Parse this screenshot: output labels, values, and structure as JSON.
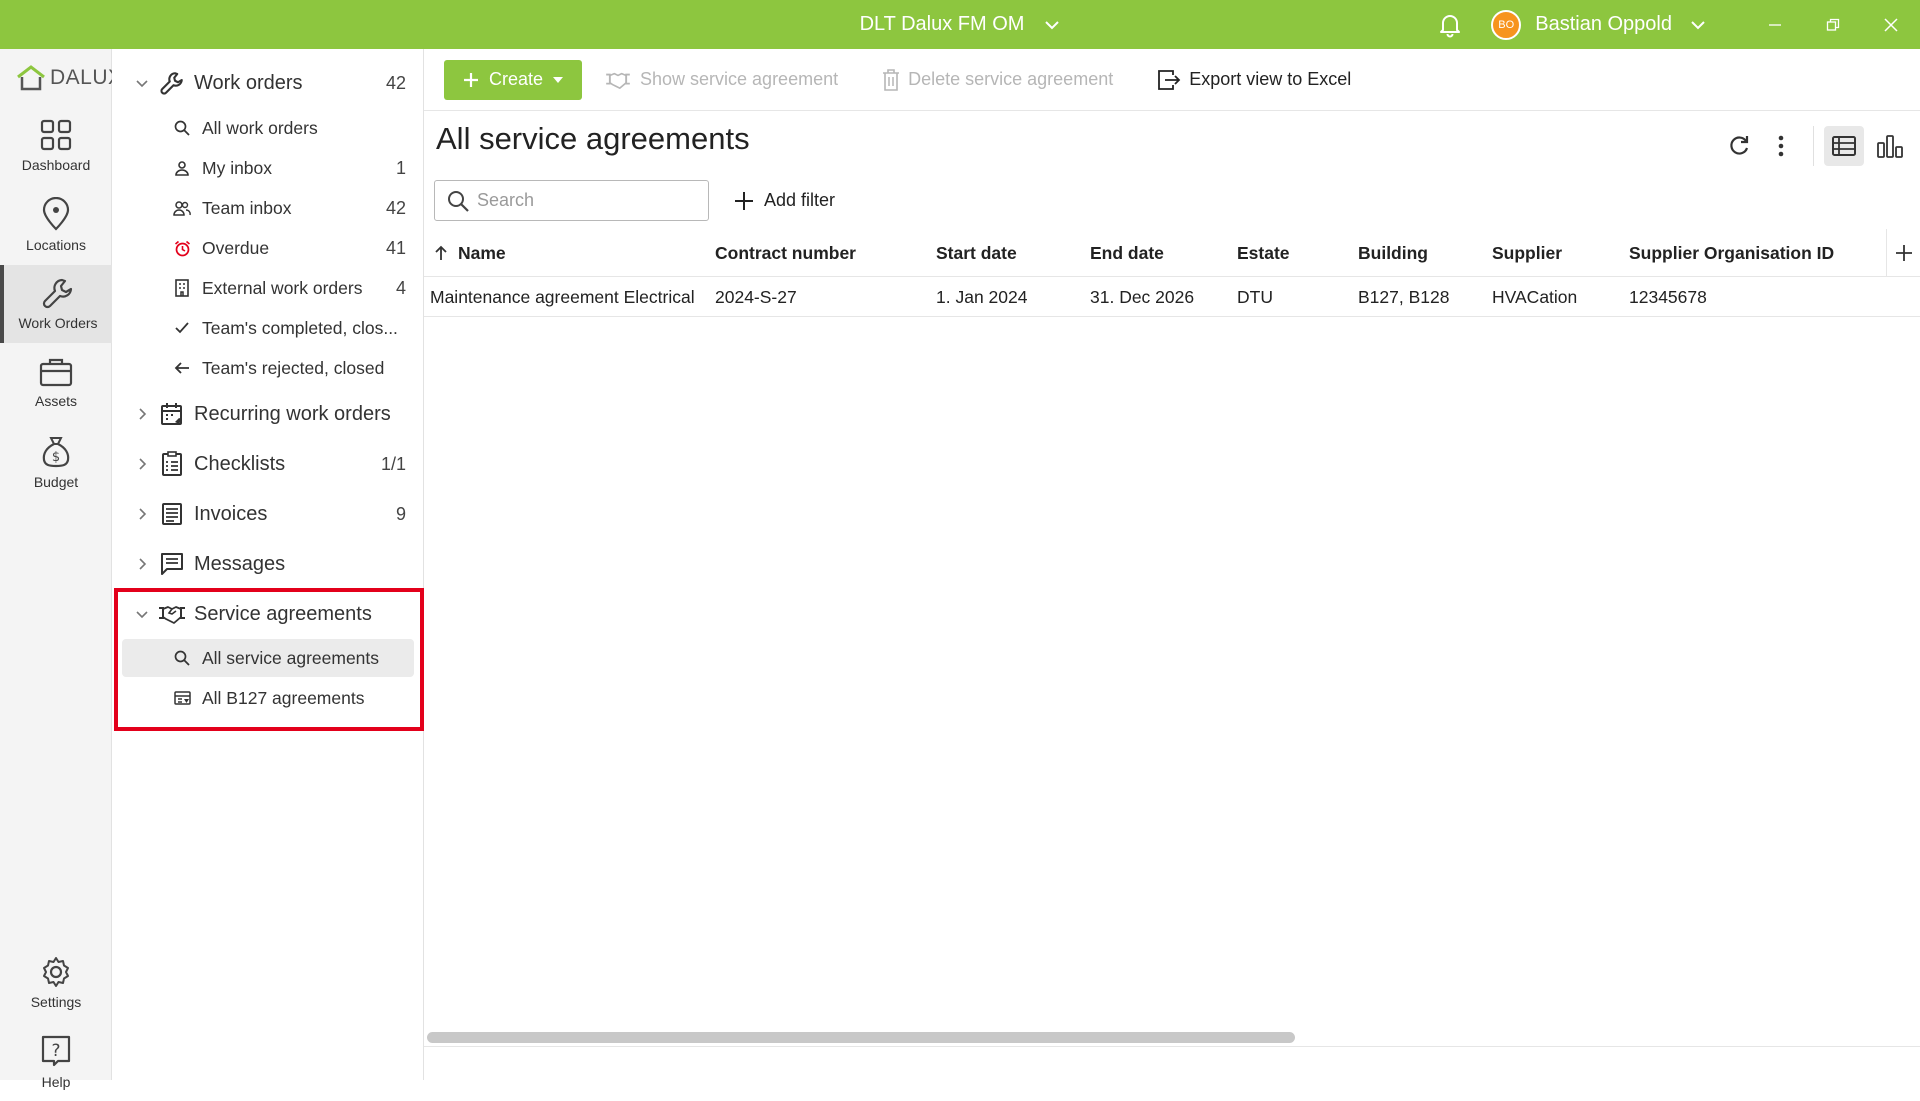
{
  "titlebar": {
    "app_title": "DLT Dalux FM OM",
    "user_initials": "BO",
    "user_name": "Bastian Oppold"
  },
  "rail": {
    "logo_text": "DALUX",
    "items": [
      {
        "label": "Dashboard",
        "icon": "dashboard-icon"
      },
      {
        "label": "Locations",
        "icon": "location-pin-icon"
      },
      {
        "label": "Work Orders",
        "icon": "wrench-icon"
      },
      {
        "label": "Assets",
        "icon": "briefcase-icon"
      },
      {
        "label": "Budget",
        "icon": "money-bag-icon"
      }
    ],
    "bottom": [
      {
        "label": "Settings",
        "icon": "gear-icon"
      },
      {
        "label": "Help",
        "icon": "help-icon"
      }
    ]
  },
  "nav": {
    "work_orders": {
      "label": "Work orders",
      "count": "42",
      "items": [
        {
          "label": "All work orders",
          "count": ""
        },
        {
          "label": "My inbox",
          "count": "1"
        },
        {
          "label": "Team inbox",
          "count": "42"
        },
        {
          "label": "Overdue",
          "count": "41"
        },
        {
          "label": "External work orders",
          "count": "4"
        },
        {
          "label": "Team's completed, clos...",
          "count": ""
        },
        {
          "label": "Team's rejected, closed",
          "count": ""
        }
      ]
    },
    "recurring": {
      "label": "Recurring work orders",
      "count": ""
    },
    "checklists": {
      "label": "Checklists",
      "count": "1/1"
    },
    "invoices": {
      "label": "Invoices",
      "count": "9"
    },
    "messages": {
      "label": "Messages",
      "count": ""
    },
    "service_agreements": {
      "label": "Service agreements",
      "items": [
        {
          "label": "All service agreements"
        },
        {
          "label": "All B127 agreements"
        }
      ]
    }
  },
  "toolbar": {
    "create_label": "Create",
    "show_label": "Show service agreement",
    "delete_label": "Delete service agreement",
    "export_label": "Export view to Excel"
  },
  "main": {
    "title": "All service agreements",
    "search_placeholder": "Search",
    "add_filter_label": "Add filter"
  },
  "table": {
    "columns": [
      "Name",
      "Contract number",
      "Start date",
      "End date",
      "Estate",
      "Building",
      "Supplier",
      "Supplier Organisation ID"
    ],
    "rows": [
      [
        "Maintenance agreement Electrical",
        "2024-S-27",
        "1. Jan 2024",
        "31. Dec 2026",
        "DTU",
        "B127, B128",
        "HVACation",
        "12345678"
      ]
    ]
  },
  "colors": {
    "brand_green": "#8dc63f",
    "avatar_orange": "#f7941d",
    "overdue_red": "#e3001b",
    "highlight_red": "#e3001b"
  }
}
